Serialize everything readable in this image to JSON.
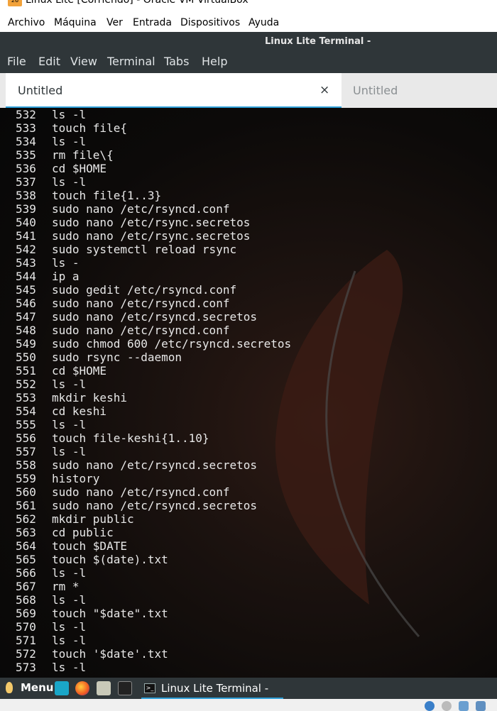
{
  "vbox": {
    "title": "Linux Lite [Corriendo] - Oracle VM VirtualBox",
    "menu": [
      "Archivo",
      "Máquina",
      "Ver",
      "Entrada",
      "Dispositivos",
      "Ayuda"
    ]
  },
  "terminal": {
    "window_title": "Linux Lite Terminal -",
    "menu": [
      "File",
      "Edit",
      "View",
      "Terminal",
      "Tabs",
      "Help"
    ],
    "tabs": [
      {
        "label": "Untitled",
        "active": true,
        "close_icon": "×"
      },
      {
        "label": "Untitled",
        "active": false
      }
    ],
    "history": [
      {
        "n": "532",
        "cmd": "ls -l"
      },
      {
        "n": "533",
        "cmd": "touch file{"
      },
      {
        "n": "534",
        "cmd": "ls -l"
      },
      {
        "n": "535",
        "cmd": "rm file\\{"
      },
      {
        "n": "536",
        "cmd": "cd $HOME"
      },
      {
        "n": "537",
        "cmd": "ls -l"
      },
      {
        "n": "538",
        "cmd": "touch file{1..3}"
      },
      {
        "n": "539",
        "cmd": "sudo nano /etc/rsyncd.conf"
      },
      {
        "n": "540",
        "cmd": "sudo nano /etc/rsync.secretos"
      },
      {
        "n": "541",
        "cmd": "sudo nano /etc/rsync.secretos"
      },
      {
        "n": "542",
        "cmd": "sudo systemctl reload rsync"
      },
      {
        "n": "543",
        "cmd": "ls -"
      },
      {
        "n": "544",
        "cmd": "ip a"
      },
      {
        "n": "545",
        "cmd": "sudo gedit /etc/rsyncd.conf"
      },
      {
        "n": "546",
        "cmd": "sudo nano /etc/rsyncd.conf"
      },
      {
        "n": "547",
        "cmd": "sudo nano /etc/rsyncd.secretos"
      },
      {
        "n": "548",
        "cmd": "sudo nano /etc/rsyncd.conf"
      },
      {
        "n": "549",
        "cmd": "sudo chmod 600 /etc/rsyncd.secretos"
      },
      {
        "n": "550",
        "cmd": "sudo rsync --daemon"
      },
      {
        "n": "551",
        "cmd": "cd $HOME"
      },
      {
        "n": "552",
        "cmd": "ls -l"
      },
      {
        "n": "553",
        "cmd": "mkdir keshi"
      },
      {
        "n": "554",
        "cmd": "cd keshi"
      },
      {
        "n": "555",
        "cmd": "ls -l"
      },
      {
        "n": "556",
        "cmd": "touch file-keshi{1..10}"
      },
      {
        "n": "557",
        "cmd": "ls -l"
      },
      {
        "n": "558",
        "cmd": "sudo nano /etc/rsyncd.secretos"
      },
      {
        "n": "559",
        "cmd": "history"
      },
      {
        "n": "560",
        "cmd": "sudo nano /etc/rsyncd.conf"
      },
      {
        "n": "561",
        "cmd": "sudo nano /etc/rsyncd.secretos"
      },
      {
        "n": "562",
        "cmd": "mkdir public"
      },
      {
        "n": "563",
        "cmd": "cd public"
      },
      {
        "n": "564",
        "cmd": "touch $DATE"
      },
      {
        "n": "565",
        "cmd": "touch $(date).txt"
      },
      {
        "n": "566",
        "cmd": "ls -l"
      },
      {
        "n": "567",
        "cmd": "rm *"
      },
      {
        "n": "568",
        "cmd": "ls -l"
      },
      {
        "n": "569",
        "cmd": "touch \"$date\".txt"
      },
      {
        "n": "570",
        "cmd": "ls -l"
      },
      {
        "n": "571",
        "cmd": "ls -l"
      },
      {
        "n": "572",
        "cmd": "touch '$date'.txt"
      },
      {
        "n": "573",
        "cmd": "ls -l"
      }
    ]
  },
  "taskbar": {
    "menu_label": "Menu",
    "launchers": [
      "files-icon",
      "firefox-icon",
      "package-icon",
      "terminal-icon"
    ],
    "task_label": "Linux Lite Terminal -"
  },
  "colors": {
    "accent": "#2e9fd8",
    "titlebar": "#2f3639",
    "terminal_text": "#e8e8e8"
  }
}
